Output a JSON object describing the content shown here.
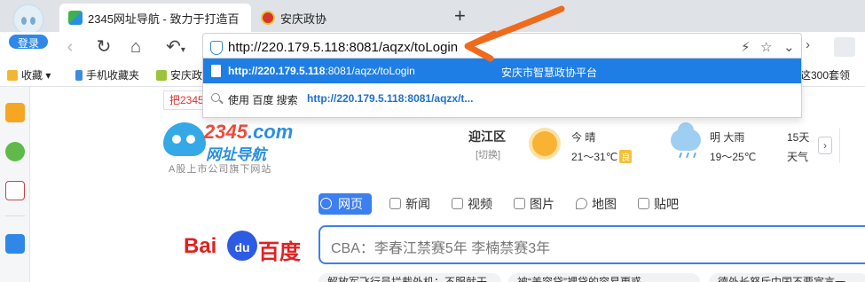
{
  "browser": {
    "login_label": "登录",
    "tabs": [
      {
        "title": "2345网址导航 - 致力于打造百",
        "active": true,
        "icon": "2345-favicon"
      },
      {
        "title": "安庆政协",
        "active": false,
        "icon": "emblem-favicon"
      }
    ],
    "newtab_label": "+",
    "address": {
      "url": "http://220.179.5.118:8081/aqzx/toLogin"
    },
    "bookmarks": [
      {
        "label": "收藏",
        "icon": "star-icon"
      },
      {
        "label": "手机收藏夹",
        "icon": "phone-icon"
      },
      {
        "label": "安庆政",
        "icon": "leaf-icon"
      },
      {
        "label": "这300套领",
        "icon": "pin-icon"
      }
    ]
  },
  "suggestions": {
    "primary": {
      "url_bold": "http://220.179.5.118",
      "url_rest": ":8081/aqzx/toLogin",
      "title": "安庆市智慧政协平台"
    },
    "search": {
      "prefix": "使用 百度 搜索",
      "query": "http://220.179.5.118:8081/aqzx/t..."
    }
  },
  "page": {
    "top_button": "把2345",
    "logo": {
      "brand_main": "2345",
      "brand_tld": ".com",
      "subtitle": "网址导航",
      "tagline": "A股上市公司旗下网站"
    },
    "weather": {
      "city": "迎江区",
      "switch": "[切换]",
      "today_label": "今 晴",
      "today_temp": "21～31℃",
      "today_aqi": "良",
      "tomorrow_label": "明 大雨",
      "tomorrow_temp": "19～25℃",
      "forecast_label_1": "15天",
      "forecast_label_2": "天气",
      "next_symbol": "›"
    },
    "search_tabs": [
      "网页",
      "新闻",
      "视频",
      "图片",
      "地图",
      "贴吧"
    ],
    "baidu": {
      "bai": "Bai",
      "du": "du",
      "cn": "百度"
    },
    "search_query": "CBA：李春江禁赛5年 李楠禁赛3年",
    "news": [
      "解放军飞行员拦截外机：不服就干",
      "被“美容贷”裸贷的容易更惑",
      "德外长怒斥中国不要宣言一"
    ]
  },
  "colors": {
    "accent": "#1f7ee6",
    "arrow": "#f06a1d",
    "baidu_red": "#e02020",
    "baidu_blue": "#2d5be3"
  }
}
